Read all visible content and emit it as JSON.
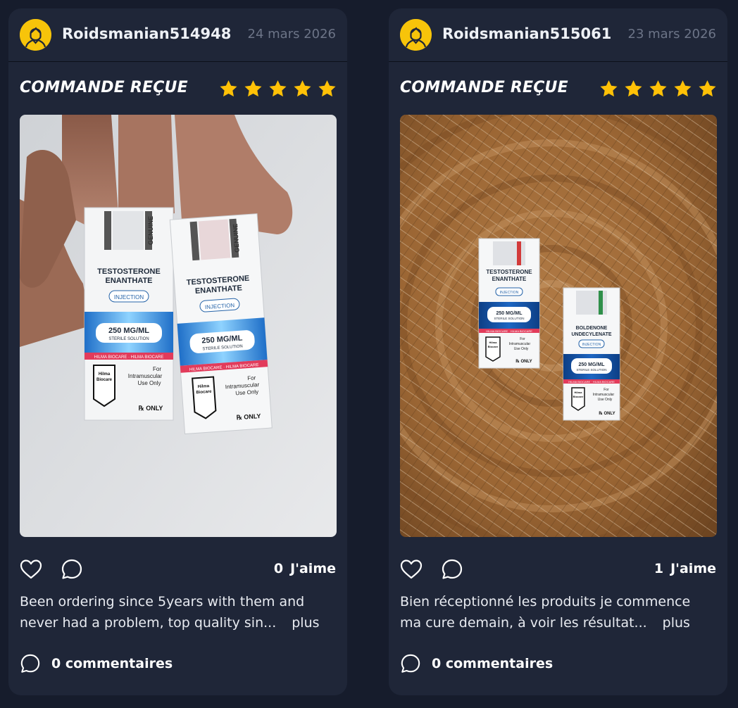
{
  "reviews": [
    {
      "username": "Roidsmanian514948",
      "date": "24 mars 2026",
      "status": "COMMANDE REÇUE",
      "rating": 5,
      "likes": "0",
      "likes_label": "J'aime",
      "text_line1": "Been ordering since 5years with them and",
      "text_line2": "never had a problem, top quality sin...",
      "more_label": "plus",
      "comments": "0 commentaires",
      "photo": {
        "boxes": [
          {
            "line1": "TESTOSTERONE",
            "line2": "ENANTHATE",
            "tag": "INJECTION",
            "dose": "250 MG/ML",
            "sub": "STERILE SOLUTION",
            "band": "HILMA BIOCARE",
            "brand1": "Hilma",
            "brand2": "Biocare",
            "use1": "For",
            "use2": "Intramuscular",
            "use3": "Use Only",
            "rx": "℞ ONLY",
            "seal": "GENUINE"
          },
          {
            "line1": "TESTOSTERONE",
            "line2": "ENANTHATE",
            "tag": "INJECTION",
            "dose": "250 MG/ML",
            "sub": "STERILE SOLUTION",
            "band": "HILMA BIOCARE",
            "brand1": "Hilma",
            "brand2": "Biocare",
            "use1": "For",
            "use2": "Intramuscular",
            "use3": "Use Only",
            "rx": "℞ ONLY",
            "seal": "GENUINE"
          }
        ]
      }
    },
    {
      "username": "Roidsmanian515061",
      "date": "23 mars 2026",
      "status": "COMMANDE REÇUE",
      "rating": 5,
      "likes": "1",
      "likes_label": "J'aime",
      "text_line1": "Bien réceptionné les produits je commence",
      "text_line2": "ma cure demain, à voir les résultat...",
      "more_label": "plus",
      "comments": "0 commentaires",
      "photo": {
        "boxes": [
          {
            "line1": "TESTOSTERONE",
            "line2": "ENANTHATE",
            "tag": "INJECTION",
            "dose": "250 MG/ML",
            "sub": "STERILE SOLUTION",
            "band": "HILMA BIOCARE",
            "brand1": "Hilma",
            "brand2": "Biocare",
            "use1": "For",
            "use2": "Intramuscular",
            "use3": "Use Only",
            "rx": "℞ ONLY"
          },
          {
            "line1": "BOLDENONE",
            "line2": "UNDECYLENATE",
            "tag": "INJECTION",
            "dose": "250 MG/ML",
            "sub": "STERILE SOLUTION",
            "band": "HILMA BIOCARE",
            "brand1": "Hilma",
            "brand2": "Biocare",
            "use1": "For",
            "use2": "Intramuscular",
            "use3": "Use Only",
            "rx": "℞ ONLY"
          }
        ]
      }
    }
  ],
  "colors": {
    "background": "#161c2c",
    "card": "#1f2638",
    "star": "#ffc107",
    "avatar": "#f7c40a",
    "muted_text": "#6c7487"
  },
  "icons": [
    "user-avatar-icon",
    "star-icon",
    "heart-icon",
    "comment-bubble-icon"
  ]
}
